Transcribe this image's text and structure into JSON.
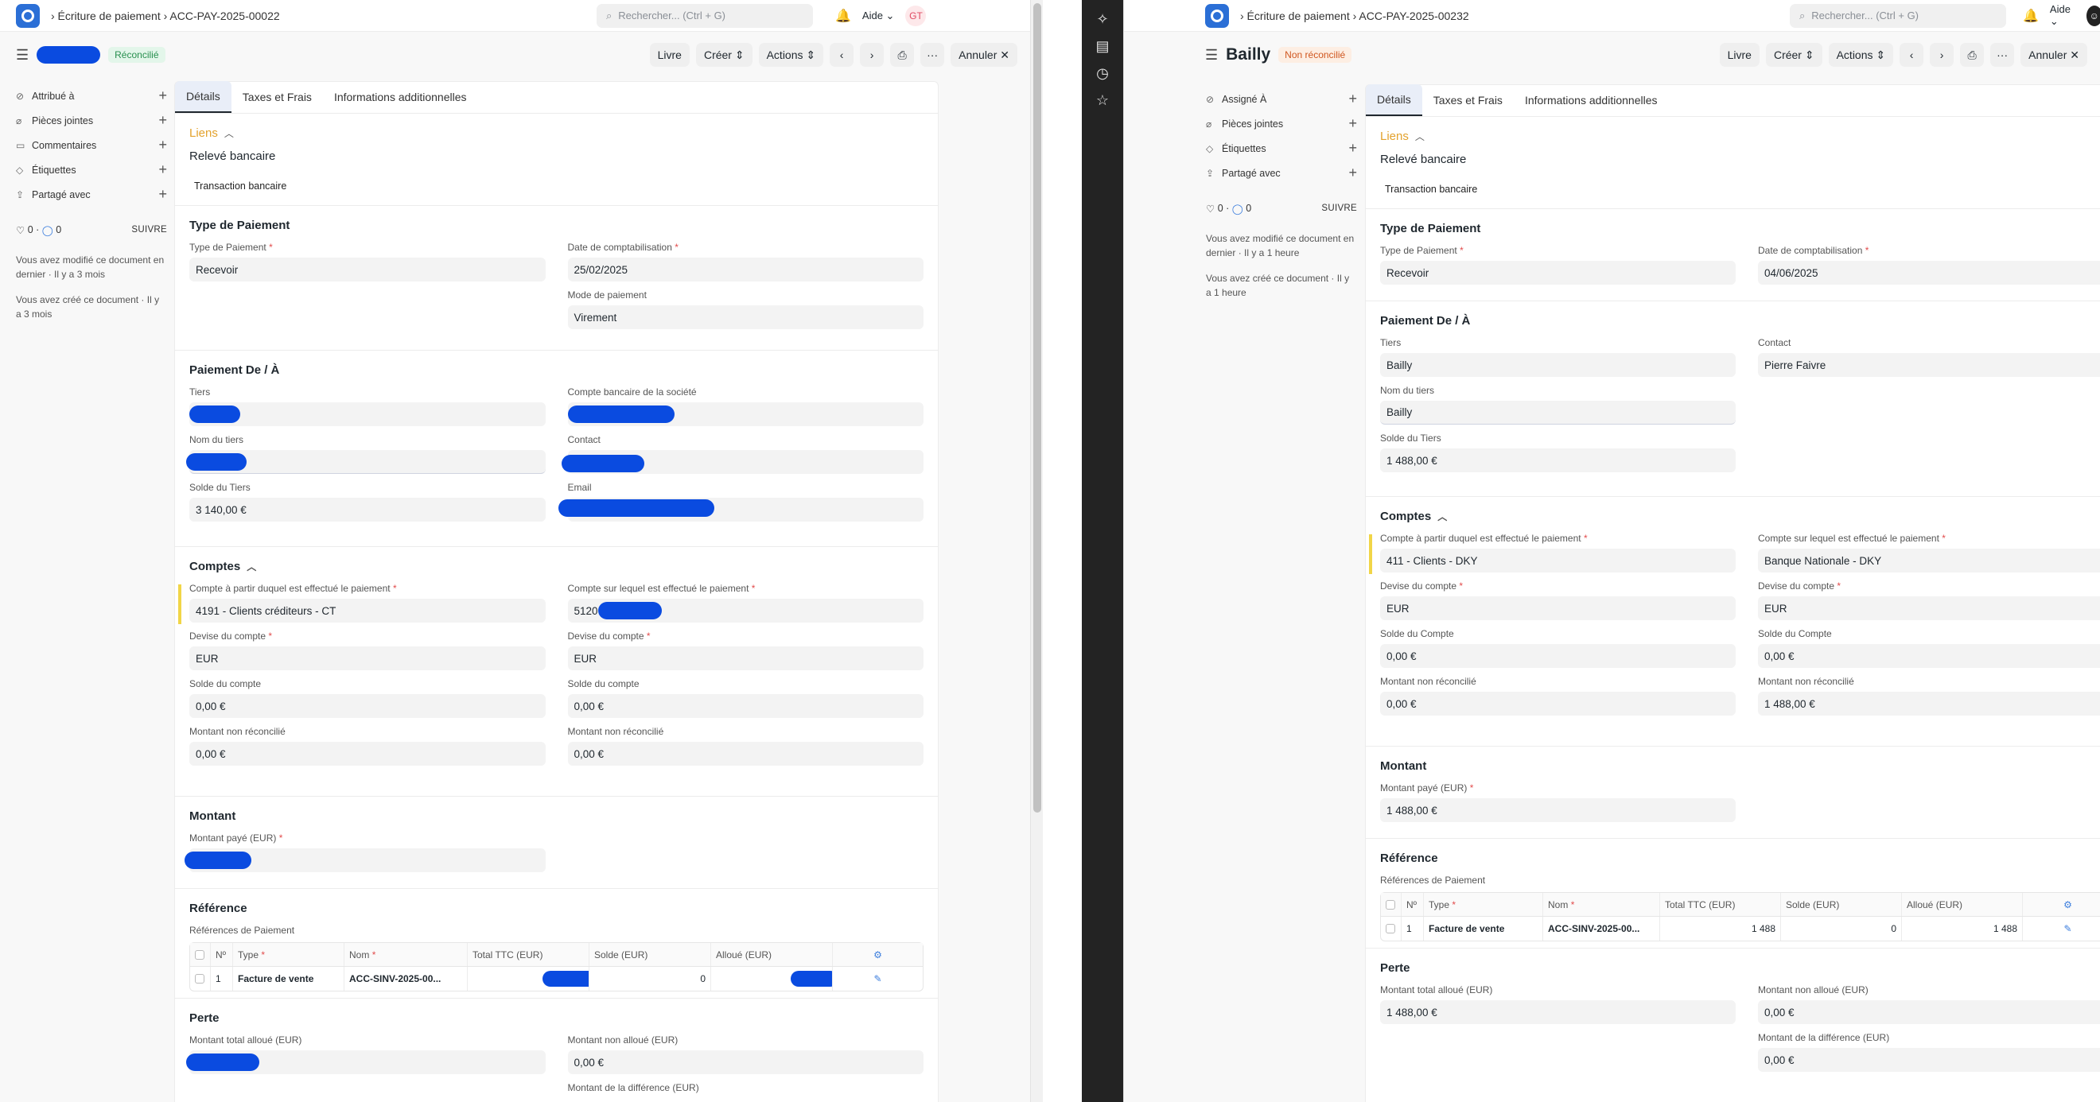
{
  "left": {
    "breadcrumb": "› Écriture de paiement › ACC-PAY-2025-00022",
    "search_placeholder": "Rechercher... (Ctrl + G)",
    "help": "Aide ⌄",
    "user_initials": "GT",
    "status": "Réconcilié",
    "buttons": {
      "livre": "Livre",
      "creer": "Créer ⇕",
      "actions": "Actions ⇕",
      "annuler": "Annuler ✕"
    },
    "sidebar": {
      "items": [
        "Attribué à",
        "Pièces jointes",
        "Commentaires",
        "Étiquettes",
        "Partagé avec"
      ],
      "likes": "0",
      "comments": "0",
      "follow": "SUIVRE",
      "notes": [
        "Vous avez modifié ce document en dernier · Il y a 3 mois",
        "Vous avez créé ce document · Il y a 3 mois"
      ]
    },
    "tabs": [
      "Détails",
      "Taxes et Frais",
      "Informations additionnelles"
    ],
    "links": {
      "title": "Liens",
      "sub": "Relevé bancaire",
      "item": "Transaction bancaire"
    },
    "payment_type": {
      "title": "Type de Paiement",
      "type_label": "Type de Paiement",
      "type": "Recevoir",
      "date_label": "Date de comptabilisation",
      "date": "25/02/2025",
      "mode_label": "Mode de paiement",
      "mode": "Virement"
    },
    "party": {
      "title": "Paiement De / À",
      "tiers_label": "Tiers",
      "bank_label": "Compte bancaire de la société",
      "name_label": "Nom du tiers",
      "contact_label": "Contact",
      "balance_label": "Solde du Tiers",
      "balance": "3 140,00 €",
      "email_label": "Email"
    },
    "accounts": {
      "title": "Comptes",
      "from_label": "Compte à partir duquel est effectué le paiement",
      "from": "4191 - Clients créditeurs - CT",
      "to_label": "Compte sur lequel est effectué le paiement",
      "to": "5120",
      "cur_label": "Devise du compte",
      "cur_from": "EUR",
      "cur_to": "EUR",
      "bal_label": "Solde du compte",
      "bal_from": "0,00 €",
      "bal_to": "0,00 €",
      "unrec_label": "Montant non réconcilié",
      "unrec_from": "0,00 €",
      "unrec_to": "0,00 €"
    },
    "amount": {
      "title": "Montant",
      "paid_label": "Montant payé (EUR)"
    },
    "reference": {
      "title": "Référence",
      "table_label": "Références de Paiement",
      "headers": [
        "Nº",
        "Type",
        "Nom",
        "Total TTC (EUR)",
        "Solde (EUR)",
        "Alloué (EUR)"
      ],
      "row": {
        "no": "1",
        "type": "Facture de vente",
        "name": "ACC-SINV-2025-00...",
        "total": "",
        "solde": "0",
        "alloue": ""
      }
    },
    "loss": {
      "title": "Perte",
      "total_label": "Montant total alloué (EUR)",
      "unalloc_label": "Montant non alloué (EUR)",
      "unalloc": "0,00 €",
      "diff_label": "Montant de la différence (EUR)"
    }
  },
  "right": {
    "breadcrumb": "› Écriture de paiement › ACC-PAY-2025-00232",
    "search_placeholder": "Rechercher... (Ctrl + G)",
    "help": "Aide ⌄",
    "doc_title": "Bailly",
    "status": "Non réconcilié",
    "buttons": {
      "livre": "Livre",
      "creer": "Créer ⇕",
      "actions": "Actions ⇕",
      "annuler": "Annuler ✕"
    },
    "sidebar": {
      "items": [
        "Assigné À",
        "Pièces jointes",
        "Étiquettes",
        "Partagé avec"
      ],
      "likes": "0",
      "comments": "0",
      "follow": "SUIVRE",
      "notes": [
        "Vous avez modifié ce document en dernier · Il y a 1 heure",
        "Vous avez créé ce document · Il y a 1 heure"
      ]
    },
    "tabs": [
      "Détails",
      "Taxes et Frais",
      "Informations additionnelles"
    ],
    "links": {
      "title": "Liens",
      "sub": "Relevé bancaire",
      "item": "Transaction bancaire"
    },
    "payment_type": {
      "title": "Type de Paiement",
      "type_label": "Type de Paiement",
      "type": "Recevoir",
      "date_label": "Date de comptabilisation",
      "date": "04/06/2025"
    },
    "party": {
      "title": "Paiement De / À",
      "tiers_label": "Tiers",
      "tiers": "Bailly",
      "contact_label": "Contact",
      "contact": "Pierre Faivre",
      "name_label": "Nom du tiers",
      "name": "Bailly",
      "balance_label": "Solde du Tiers",
      "balance": "1 488,00 €"
    },
    "accounts": {
      "title": "Comptes",
      "from_label": "Compte à partir duquel est effectué le paiement",
      "from": "411 - Clients - DKY",
      "to_label": "Compte sur lequel est effectué le paiement",
      "to": "Banque Nationale - DKY",
      "cur_label": "Devise du compte",
      "cur_from": "EUR",
      "cur_to": "EUR",
      "bal_label": "Solde du Compte",
      "bal_from": "0,00 €",
      "bal_to": "0,00 €",
      "unrec_label": "Montant non réconcilié",
      "unrec_from": "0,00 €",
      "unrec_to": "1 488,00 €"
    },
    "amount": {
      "title": "Montant",
      "paid_label": "Montant payé (EUR)",
      "paid": "1 488,00 €"
    },
    "reference": {
      "title": "Référence",
      "table_label": "Références de Paiement",
      "headers": [
        "Nº",
        "Type",
        "Nom",
        "Total TTC (EUR)",
        "Solde (EUR)",
        "Alloué (EUR)"
      ],
      "row": {
        "no": "1",
        "type": "Facture de vente",
        "name": "ACC-SINV-2025-00...",
        "total": "1 488",
        "solde": "0",
        "alloue": "1 488"
      }
    },
    "loss": {
      "title": "Perte",
      "total_label": "Montant total alloué (EUR)",
      "total": "1 488,00 €",
      "unalloc_label": "Montant non alloué (EUR)",
      "unalloc": "0,00 €",
      "diff_label": "Montant de la différence (EUR)",
      "diff": "0,00 €"
    }
  }
}
